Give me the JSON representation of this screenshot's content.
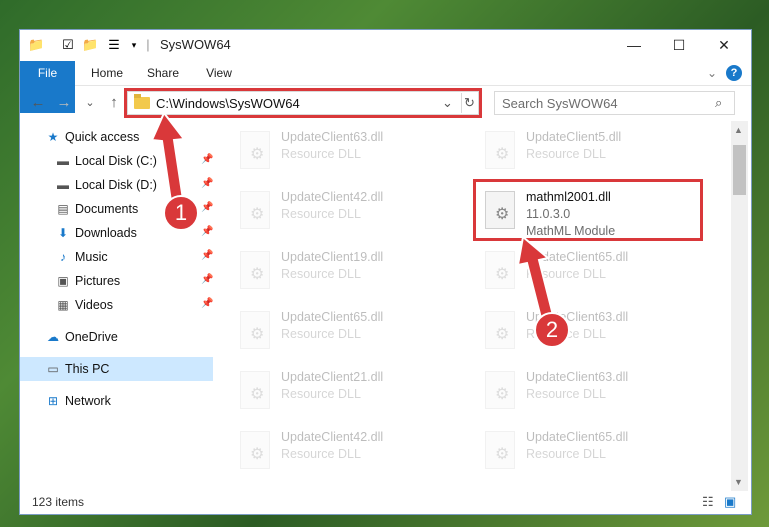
{
  "window": {
    "title": "SysWOW64",
    "minimize_glyph": "—",
    "maximize_glyph": "☐",
    "close_glyph": "✕"
  },
  "ribbon": {
    "tabs": [
      "File",
      "Home",
      "Share",
      "View"
    ],
    "collapse_glyph": "⌄",
    "help_glyph": "?"
  },
  "address": {
    "path": "C:\\Windows\\SysWOW64",
    "dropdown_glyph": "⌄",
    "refresh_glyph": "↻",
    "search_placeholder": "Search SysWOW64"
  },
  "nav": {
    "back": "←",
    "forward": "→",
    "recent": "⌄",
    "up": "↑"
  },
  "sidebar": [
    {
      "label": "Quick access",
      "icon": "star-icon",
      "glyph": "★",
      "pinned": false
    },
    {
      "label": "Local Disk (C:)",
      "icon": "drive-icon",
      "glyph": "▬",
      "pinned": true
    },
    {
      "label": "Local Disk (D:)",
      "icon": "drive-icon",
      "glyph": "▬",
      "pinned": true
    },
    {
      "label": "Documents",
      "icon": "documents-icon",
      "glyph": "▤",
      "pinned": true
    },
    {
      "label": "Downloads",
      "icon": "downloads-icon",
      "glyph": "⬇",
      "pinned": true
    },
    {
      "label": "Music",
      "icon": "music-icon",
      "glyph": "♪",
      "pinned": true
    },
    {
      "label": "Pictures",
      "icon": "pictures-icon",
      "glyph": "▣",
      "pinned": true
    },
    {
      "label": "Videos",
      "icon": "videos-icon",
      "glyph": "▦",
      "pinned": true
    },
    {
      "label": "OneDrive",
      "icon": "cloud-icon",
      "glyph": "☁",
      "pinned": false
    },
    {
      "label": "This PC",
      "icon": "computer-icon",
      "glyph": "▭",
      "pinned": false,
      "selected": true
    },
    {
      "label": "Network",
      "icon": "network-icon",
      "glyph": "⊞",
      "pinned": false
    }
  ],
  "pin_glyph": "📌",
  "files": [
    {
      "name": "UpdateClient63.dll",
      "type": "Resource DLL"
    },
    {
      "name": "UpdateClient5.dll",
      "type": "Resource DLL"
    },
    {
      "name": "UpdateClient42.dll",
      "type": "Resource DLL"
    },
    {
      "name": "mathml2001.dll",
      "version": "11.0.3.0",
      "type": "MathML Module",
      "highlighted": true
    },
    {
      "name": "UpdateClient19.dll",
      "type": "Resource DLL"
    },
    {
      "name": "UpdateClient65.dll",
      "type": "Resource DLL"
    },
    {
      "name": "UpdateClient65.dll",
      "type": "Resource DLL"
    },
    {
      "name": "UpdateClient63.dll",
      "type": "Resource DLL"
    },
    {
      "name": "UpdateClient21.dll",
      "type": "Resource DLL"
    },
    {
      "name": "UpdateClient63.dll",
      "type": "Resource DLL"
    },
    {
      "name": "UpdateClient42.dll",
      "type": "Resource DLL"
    },
    {
      "name": "UpdateClient65.dll",
      "type": "Resource DLL"
    }
  ],
  "status": {
    "item_count": "123 items"
  },
  "badges": [
    "1",
    "2"
  ],
  "accent": "#1979ca",
  "highlight_color": "#d9383a"
}
